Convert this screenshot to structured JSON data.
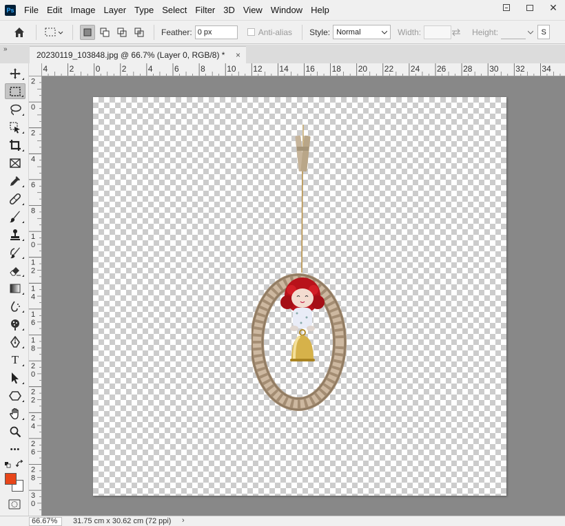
{
  "app": {
    "logo_text": "Ps"
  },
  "menu": [
    "File",
    "Edit",
    "Image",
    "Layer",
    "Type",
    "Select",
    "Filter",
    "3D",
    "View",
    "Window",
    "Help"
  ],
  "options": {
    "feather_label": "Feather:",
    "feather_value": "0 px",
    "antialias_label": "Anti-alias",
    "style_label": "Style:",
    "style_value": "Normal",
    "width_label": "Width:",
    "height_label": "Height:",
    "cut_label": "S"
  },
  "document_tab": {
    "title": "20230119_103848.jpg @ 66.7% (Layer 0, RGB/8) *",
    "close": "×"
  },
  "tools": [
    {
      "name": "move-tool",
      "icon": "move-icon"
    },
    {
      "name": "rectangular-marquee-tool",
      "icon": "marquee-icon",
      "active": true
    },
    {
      "name": "lasso-tool",
      "icon": "lasso-icon"
    },
    {
      "name": "object-selection-tool",
      "icon": "object-selection-icon"
    },
    {
      "name": "crop-tool",
      "icon": "crop-icon"
    },
    {
      "name": "frame-tool",
      "icon": "frame-icon"
    },
    {
      "name": "eyedropper-tool",
      "icon": "eyedropper-icon"
    },
    {
      "name": "healing-brush-tool",
      "icon": "bandage-icon"
    },
    {
      "name": "brush-tool",
      "icon": "brush-icon"
    },
    {
      "name": "clone-stamp-tool",
      "icon": "stamp-icon"
    },
    {
      "name": "history-brush-tool",
      "icon": "history-brush-icon"
    },
    {
      "name": "eraser-tool",
      "icon": "eraser-icon"
    },
    {
      "name": "gradient-tool",
      "icon": "gradient-icon"
    },
    {
      "name": "blur-tool",
      "icon": "blur-icon"
    },
    {
      "name": "dodge-tool",
      "icon": "dodge-icon"
    },
    {
      "name": "pen-tool",
      "icon": "pen-icon"
    },
    {
      "name": "type-tool",
      "icon": "type-icon",
      "glyph": "T"
    },
    {
      "name": "path-selection-tool",
      "icon": "arrow-icon"
    },
    {
      "name": "shape-tool",
      "icon": "hexagon-icon"
    },
    {
      "name": "hand-tool",
      "icon": "hand-icon"
    },
    {
      "name": "zoom-tool",
      "icon": "zoom-icon"
    },
    {
      "name": "more-tools",
      "icon": "more-icon",
      "glyph": "•••"
    }
  ],
  "colors": {
    "foreground": "#e8461a",
    "background": "#ffffff",
    "pasteboard": "#888888"
  },
  "ruler_top": [
    "4",
    "2",
    "0",
    "2",
    "4",
    "6",
    "8",
    "10",
    "12",
    "14",
    "16",
    "18",
    "20",
    "22",
    "24",
    "26",
    "28",
    "30",
    "32",
    "34"
  ],
  "ruler_left": [
    "2",
    "0",
    "2",
    "4",
    "6",
    "8",
    "10",
    "12",
    "14",
    "16",
    "18",
    "20",
    "22",
    "24",
    "26",
    "28",
    "30"
  ],
  "status": {
    "zoom": "66.67%",
    "doc_size": "31.75 cm x 30.62 cm (72 ppi)",
    "arrow": "›"
  }
}
